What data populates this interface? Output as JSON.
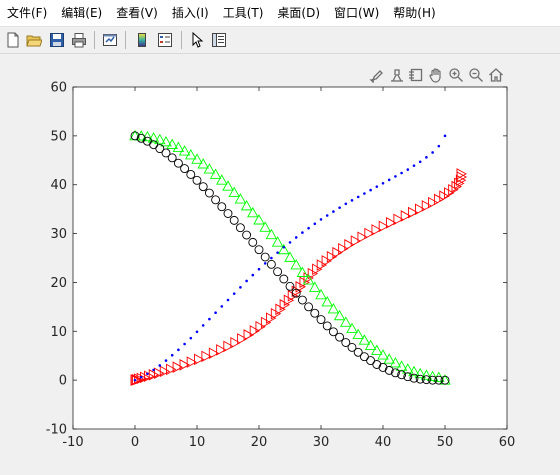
{
  "menubar": {
    "items": [
      "文件(F)",
      "编辑(E)",
      "查看(V)",
      "插入(I)",
      "工具(T)",
      "桌面(D)",
      "窗口(W)",
      "帮助(H)"
    ]
  },
  "toolbar": {
    "buttons": [
      "new-figure-icon",
      "open-folder-icon",
      "save-icon",
      "print-icon",
      "link-plot-icon",
      "colorbar-icon",
      "legend-icon",
      "pointer-icon",
      "property-inspector-icon"
    ]
  },
  "axes_toolbar": {
    "buttons": [
      "brush-icon",
      "data-cursor-icon",
      "edit-plot-icon",
      "pan-hand-icon",
      "zoom-in-icon",
      "zoom-out-icon",
      "home-icon"
    ]
  },
  "colors": {
    "series_red": "#ff0000",
    "series_green": "#00ff00",
    "series_black": "#000000",
    "series_blue": "#0000ff"
  },
  "chart_data": {
    "type": "scatter",
    "title": "",
    "xlabel": "",
    "ylabel": "",
    "xlim": [
      -10,
      60
    ],
    "ylim": [
      -10,
      60
    ],
    "xticks": [
      -10,
      0,
      10,
      20,
      30,
      40,
      50,
      60
    ],
    "yticks": [
      -10,
      0,
      10,
      20,
      30,
      40,
      50,
      60
    ],
    "grid": false,
    "series": [
      {
        "marker": "triangle-right",
        "color": "#ff0000",
        "x": [
          0.0,
          0.06,
          0.25,
          0.56,
          0.99,
          1.53,
          2.18,
          2.94,
          3.79,
          4.72,
          5.73,
          6.79,
          7.91,
          9.06,
          10.24,
          11.43,
          12.63,
          13.81,
          14.97,
          16.1,
          17.19,
          18.23,
          19.22,
          20.15,
          21.03,
          21.85,
          22.63,
          23.36,
          24.05,
          24.72,
          25.36,
          25.99,
          26.61,
          27.25,
          27.9,
          28.58,
          29.29,
          30.03,
          30.82,
          31.66,
          32.55,
          33.49,
          34.48,
          35.52,
          36.6,
          37.71,
          38.86,
          40.03,
          41.21,
          42.4,
          43.58,
          44.75,
          45.88,
          46.97,
          47.99,
          48.94,
          49.8,
          50.57,
          51.23,
          51.77,
          52.19,
          52.47,
          52.6,
          52.58
        ],
        "y": [
          0.0,
          0.02,
          0.09,
          0.2,
          0.36,
          0.56,
          0.8,
          1.09,
          1.42,
          1.79,
          2.2,
          2.65,
          3.14,
          3.68,
          4.25,
          4.86,
          5.51,
          6.19,
          6.91,
          7.66,
          8.44,
          9.25,
          10.08,
          10.93,
          11.8,
          12.69,
          13.59,
          14.5,
          15.42,
          16.34,
          17.26,
          18.18,
          19.1,
          20.01,
          20.91,
          21.81,
          22.69,
          23.56,
          24.42,
          25.26,
          26.09,
          26.9,
          27.7,
          28.48,
          29.25,
          30.01,
          30.75,
          31.48,
          32.2,
          32.91,
          33.61,
          34.3,
          34.98,
          35.66,
          36.33,
          36.99,
          37.65,
          38.31,
          38.97,
          39.62,
          40.27,
          40.92,
          41.57,
          42.22
        ]
      },
      {
        "marker": "triangle-up",
        "color": "#00ff00",
        "x": [
          0.0,
          1.0,
          2.0,
          3.0,
          4.0,
          5.0,
          6.0,
          7.0,
          8.0,
          9.0,
          10.0,
          11.0,
          12.0,
          13.0,
          14.0,
          15.0,
          16.0,
          17.0,
          18.0,
          19.0,
          20.0,
          21.0,
          22.0,
          23.0,
          24.0,
          25.0,
          26.0,
          27.0,
          28.0,
          29.0,
          30.0,
          31.0,
          32.0,
          33.0,
          34.0,
          35.0,
          36.0,
          37.0,
          38.0,
          39.0,
          40.0,
          41.0,
          42.0,
          43.0,
          44.0,
          45.0,
          46.0,
          47.0,
          48.0,
          49.0,
          50.0
        ],
        "y": [
          50.0,
          49.95,
          49.8,
          49.56,
          49.21,
          48.77,
          48.23,
          47.61,
          46.89,
          46.09,
          45.2,
          44.24,
          43.21,
          42.1,
          40.93,
          39.69,
          38.4,
          37.06,
          35.67,
          34.24,
          32.78,
          31.29,
          29.77,
          28.24,
          26.69,
          25.13,
          23.58,
          22.03,
          20.49,
          18.97,
          17.47,
          16.0,
          14.57,
          13.18,
          11.84,
          10.56,
          9.33,
          8.17,
          7.08,
          6.07,
          5.13,
          4.28,
          3.52,
          2.84,
          2.25,
          1.74,
          1.32,
          0.98,
          0.73,
          0.56,
          0.0
        ]
      },
      {
        "marker": "circle",
        "color": "#000000",
        "x": [
          0.0,
          1.0,
          2.0,
          3.0,
          4.0,
          5.0,
          6.0,
          7.0,
          8.0,
          9.0,
          10.0,
          11.0,
          12.0,
          13.0,
          14.0,
          15.0,
          16.0,
          17.0,
          18.0,
          19.0,
          20.0,
          21.0,
          22.0,
          23.0,
          24.0,
          25.0,
          26.0,
          27.0,
          28.0,
          29.0,
          30.0,
          31.0,
          32.0,
          33.0,
          34.0,
          35.0,
          36.0,
          37.0,
          38.0,
          39.0,
          40.0,
          41.0,
          42.0,
          43.0,
          44.0,
          45.0,
          46.0,
          47.0,
          48.0,
          49.0,
          50.0
        ],
        "y": [
          50.0,
          49.5,
          48.9,
          48.2,
          47.4,
          46.5,
          45.5,
          44.4,
          43.3,
          42.1,
          40.9,
          39.6,
          38.3,
          36.9,
          35.5,
          34.1,
          32.7,
          31.2,
          29.7,
          28.2,
          26.7,
          25.2,
          23.7,
          22.2,
          20.7,
          19.2,
          17.8,
          16.4,
          15.0,
          13.7,
          12.4,
          11.1,
          9.9,
          8.8,
          7.7,
          6.7,
          5.7,
          4.8,
          4.0,
          3.2,
          2.6,
          2.0,
          1.5,
          1.1,
          0.7,
          0.4,
          0.2,
          0.1,
          0.0,
          0.0,
          0.0
        ]
      },
      {
        "marker": "dot",
        "color": "#0000ff",
        "x": [
          0.0,
          1.0,
          2.0,
          3.0,
          4.0,
          5.0,
          6.0,
          7.0,
          8.0,
          9.0,
          10.0,
          11.0,
          12.0,
          13.0,
          14.0,
          15.0,
          16.0,
          17.0,
          18.0,
          19.0,
          20.0,
          21.0,
          22.0,
          23.0,
          24.0,
          25.0,
          26.0,
          27.0,
          28.0,
          29.0,
          30.0,
          31.0,
          32.0,
          33.0,
          34.0,
          35.0,
          36.0,
          37.0,
          38.0,
          39.0,
          40.0,
          41.0,
          42.0,
          43.0,
          44.0,
          45.0,
          46.0,
          47.0,
          48.0,
          49.0,
          50.0
        ],
        "y": [
          0.0,
          0.6,
          1.3,
          2.1,
          3.0,
          4.0,
          5.1,
          6.2,
          7.4,
          8.6,
          9.9,
          11.2,
          12.5,
          13.8,
          15.1,
          16.4,
          17.7,
          19.0,
          20.3,
          21.5,
          22.7,
          23.9,
          25.0,
          26.1,
          27.2,
          28.2,
          29.2,
          30.2,
          31.1,
          32.0,
          32.9,
          33.7,
          34.5,
          35.3,
          36.1,
          36.8,
          37.5,
          38.2,
          38.9,
          39.6,
          40.3,
          41.0,
          41.7,
          42.4,
          43.1,
          43.9,
          44.7,
          45.6,
          46.6,
          47.9,
          50.0
        ]
      }
    ]
  }
}
